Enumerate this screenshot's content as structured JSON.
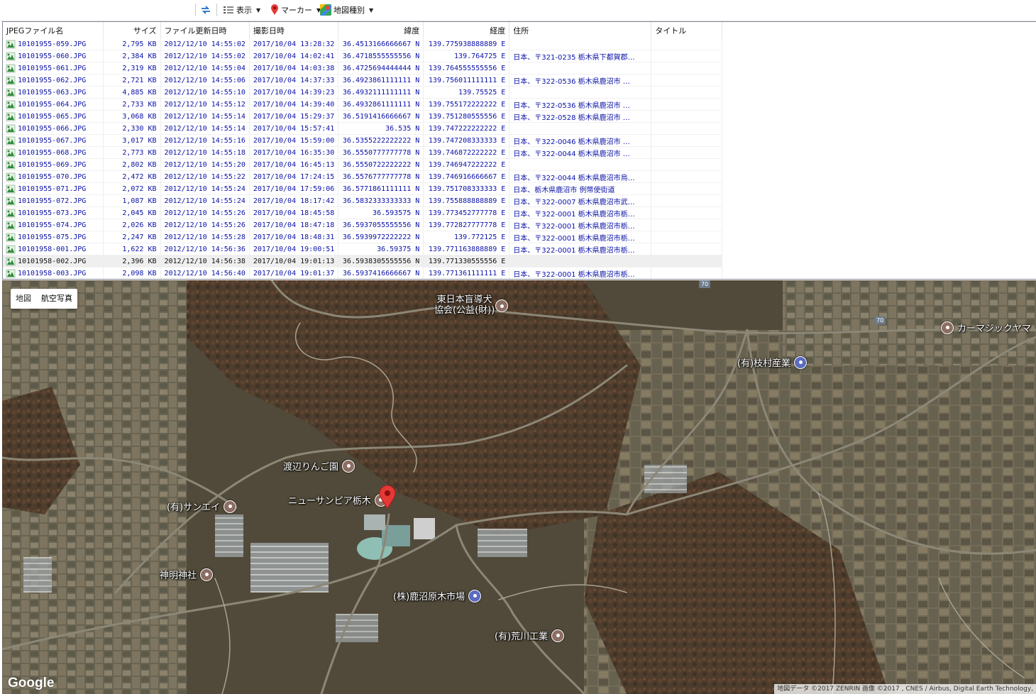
{
  "toolbar": {
    "view_label": "表示",
    "marker_label": "マーカー",
    "maptype_label": "地図種別"
  },
  "table": {
    "columns": [
      "JPEGファイル名",
      "サイズ",
      "ファイル更新日時",
      "撮影日時",
      "緯度",
      "経度",
      "住所",
      "タイトル"
    ],
    "rows": [
      [
        "10101955-059.JPG",
        "2,795 KB",
        "2012/12/10 14:55:02",
        "2017/10/04 13:28:32",
        "36.4513166666667 N",
        "139.775938888889 E",
        ""
      ],
      [
        "10101955-060.JPG",
        "2,384 KB",
        "2012/12/10 14:55:02",
        "2017/10/04 14:02:41",
        "36.4718555555556 N",
        "139.764725 E",
        "日本、〒321-0235 栃木県下都賀郡…"
      ],
      [
        "10101955-061.JPG",
        "2,319 KB",
        "2012/12/10 14:55:04",
        "2017/10/04 14:03:38",
        "36.4725694444444 N",
        "139.764555555556 E",
        ""
      ],
      [
        "10101955-062.JPG",
        "2,721 KB",
        "2012/12/10 14:55:06",
        "2017/10/04 14:37:33",
        "36.4923861111111 N",
        "139.756011111111 E",
        "日本、〒322-0536 栃木県鹿沼市 …"
      ],
      [
        "10101955-063.JPG",
        "4,885 KB",
        "2012/12/10 14:55:10",
        "2017/10/04 14:39:23",
        "36.4932111111111 N",
        "139.75525 E",
        ""
      ],
      [
        "10101955-064.JPG",
        "2,733 KB",
        "2012/12/10 14:55:12",
        "2017/10/04 14:39:40",
        "36.4932861111111 N",
        "139.755172222222 E",
        "日本、〒322-0536 栃木県鹿沼市 …"
      ],
      [
        "10101955-065.JPG",
        "3,068 KB",
        "2012/12/10 14:55:14",
        "2017/10/04 15:29:37",
        "36.5191416666667 N",
        "139.751280555556 E",
        "日本、〒322-0528 栃木県鹿沼市 …"
      ],
      [
        "10101955-066.JPG",
        "2,330 KB",
        "2012/12/10 14:55:14",
        "2017/10/04 15:57:41",
        "36.535 N",
        "139.747222222222 E",
        ""
      ],
      [
        "10101955-067.JPG",
        "3,017 KB",
        "2012/12/10 14:55:16",
        "2017/10/04 15:59:00",
        "36.5355222222222 N",
        "139.747208333333 E",
        "日本、〒322-0046 栃木県鹿沼市 …"
      ],
      [
        "10101955-068.JPG",
        "2,773 KB",
        "2012/12/10 14:55:18",
        "2017/10/04 16:35:30",
        "36.5550777777778 N",
        "139.746872222222 E",
        "日本、〒322-0044 栃木県鹿沼市 …"
      ],
      [
        "10101955-069.JPG",
        "2,802 KB",
        "2012/12/10 14:55:20",
        "2017/10/04 16:45:13",
        "36.5550722222222 N",
        "139.746947222222 E",
        ""
      ],
      [
        "10101955-070.JPG",
        "2,472 KB",
        "2012/12/10 14:55:22",
        "2017/10/04 17:24:15",
        "36.5576777777778 N",
        "139.746916666667 E",
        "日本、〒322-0044 栃木県鹿沼市烏…"
      ],
      [
        "10101955-071.JPG",
        "2,072 KB",
        "2012/12/10 14:55:24",
        "2017/10/04 17:59:06",
        "36.5771861111111 N",
        "139.751708333333 E",
        "日本、栃木県鹿沼市 例幣使街道"
      ],
      [
        "10101955-072.JPG",
        "1,087 KB",
        "2012/12/10 14:55:24",
        "2017/10/04 18:17:42",
        "36.5832333333333 N",
        "139.755888888889 E",
        "日本、〒322-0007 栃木県鹿沼市武…"
      ],
      [
        "10101955-073.JPG",
        "2,045 KB",
        "2012/12/10 14:55:26",
        "2017/10/04 18:45:58",
        "36.593575 N",
        "139.773452777778 E",
        "日本、〒322-0001 栃木県鹿沼市栃…"
      ],
      [
        "10101955-074.JPG",
        "2,026 KB",
        "2012/12/10 14:55:26",
        "2017/10/04 18:47:18",
        "36.5937055555556 N",
        "139.772827777778 E",
        "日本、〒322-0001 栃木県鹿沼市栃…"
      ],
      [
        "10101955-075.JPG",
        "2,247 KB",
        "2012/12/10 14:55:28",
        "2017/10/04 18:48:31",
        "36.5939972222222 N",
        "139.772125 E",
        "日本、〒322-0001 栃木県鹿沼市栃…"
      ],
      [
        "10101958-001.JPG",
        "1,622 KB",
        "2012/12/10 14:56:36",
        "2017/10/04 19:00:51",
        "36.59375 N",
        "139.771163888889 E",
        "日本、〒322-0001 栃木県鹿沼市栃…"
      ],
      [
        "10101958-002.JPG",
        "2,396 KB",
        "2012/12/10 14:56:38",
        "2017/10/04 19:01:13",
        "36.5938305555556 N",
        "139.771330555556 E",
        ""
      ],
      [
        "10101958-003.JPG",
        "2,098 KB",
        "2012/12/10 14:56:40",
        "2017/10/04 19:01:37",
        "36.5937416666667 N",
        "139.771361111111 E",
        "日本、〒322-0001 栃木県鹿沼市栃…"
      ]
    ],
    "selected_index": 18
  },
  "map": {
    "type_buttons": [
      "地図",
      "航空写真"
    ],
    "active_type": "航空写真",
    "pois": [
      "東日本盲導犬",
      "協会(公益(財))",
      "カーマジックヤマ",
      "(有)枝村産業",
      "渡辺りんご園",
      "ニューサンピア栃木",
      "(有)サンエイ",
      "神明神社",
      "(株)鹿沼原木市場",
      "(有)荒川工業"
    ],
    "road_shields": [
      "70",
      "70"
    ],
    "logo": "Google",
    "attribution": "地図データ ©2017 ZENRIN 画像 ©2017 , CNES / Airbus, Digital Earth Technology,",
    "marker_color": "#e53935"
  },
  "colors": {
    "table_text": "#0b12a6",
    "selected_row_bg": "#efefef"
  },
  "icons": [
    "sync-icon",
    "list-view-icon",
    "red-pin-icon",
    "google-maps-icon",
    "jpeg-gps-file-icon"
  ]
}
